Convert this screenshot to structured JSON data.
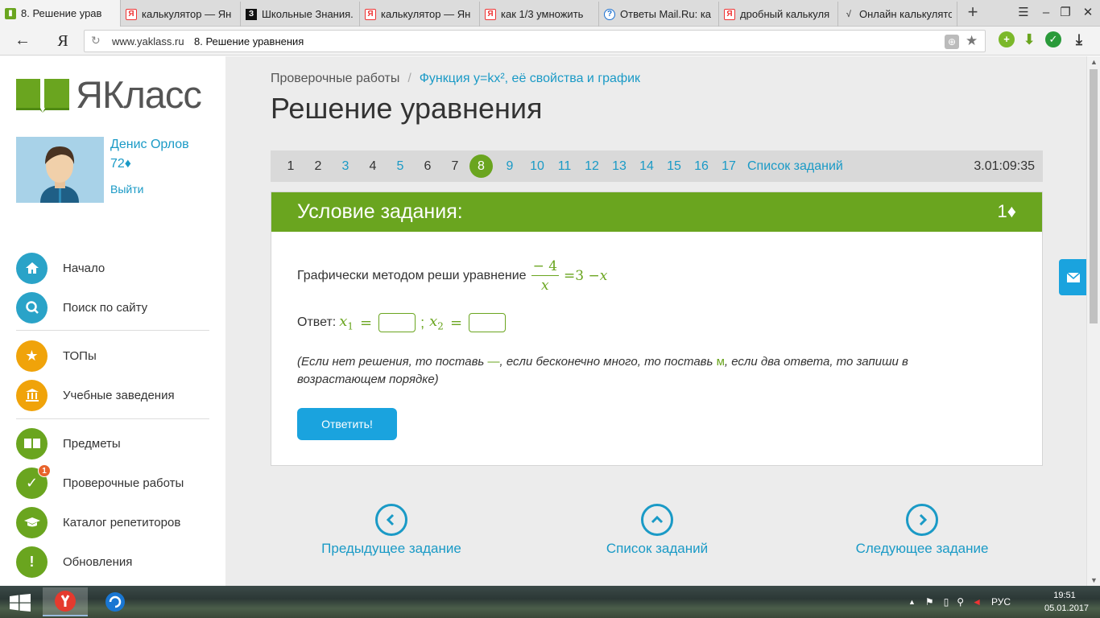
{
  "browser": {
    "tabs": [
      {
        "title": "8. Решение урав",
        "favicon": "yaklass",
        "active": true
      },
      {
        "title": "калькулятор — Ян",
        "favicon": "yandex"
      },
      {
        "title": "Школьные Знания.",
        "favicon": "znania"
      },
      {
        "title": "калькулятор — Ян",
        "favicon": "yandex"
      },
      {
        "title": "как 1/3 умножить",
        "favicon": "yandex"
      },
      {
        "title": "Ответы Mail.Ru: ка",
        "favicon": "mailru"
      },
      {
        "title": "дробный калькуля",
        "favicon": "yandex"
      },
      {
        "title": "Онлайн калькулято",
        "favicon": "calc"
      }
    ],
    "address": {
      "domain": "www.yaklass.ru",
      "page_title": "8. Решение уравнения"
    },
    "yandex_logo": "Я"
  },
  "sidebar": {
    "logo_text": "ЯКласс",
    "user": {
      "name": "Денис Орлов",
      "points": "72♦",
      "logout": "Выйти"
    },
    "menu": [
      {
        "label": "Начало",
        "icon": "home-icon",
        "color": "#2aa3c8"
      },
      {
        "label": "Поиск по сайту",
        "icon": "search-icon",
        "color": "#2aa3c8"
      },
      {
        "label": "ТОПы",
        "icon": "star-icon",
        "color": "#f0a30a"
      },
      {
        "label": "Учебные заведения",
        "icon": "school-icon",
        "color": "#f0a30a"
      },
      {
        "label": "Предметы",
        "icon": "book-icon",
        "color": "#6aa51f"
      },
      {
        "label": "Проверочные работы",
        "icon": "check-icon",
        "color": "#6aa51f",
        "badge": "1"
      },
      {
        "label": "Каталог репетиторов",
        "icon": "graduation-cap-icon",
        "color": "#6aa51f"
      },
      {
        "label": "Обновления",
        "icon": "exclamation-icon",
        "color": "#6aa51f"
      }
    ]
  },
  "main": {
    "breadcrumb": {
      "root": "Проверочные работы",
      "sep": "/",
      "current": "Функция y=kx², её свойства и график"
    },
    "title": "Решение уравнения",
    "task_numbers": [
      {
        "n": "1",
        "state": "done"
      },
      {
        "n": "2",
        "state": "done"
      },
      {
        "n": "3",
        "state": "todo"
      },
      {
        "n": "4",
        "state": "done"
      },
      {
        "n": "5",
        "state": "todo"
      },
      {
        "n": "6",
        "state": "done"
      },
      {
        "n": "7",
        "state": "done"
      },
      {
        "n": "8",
        "state": "current"
      },
      {
        "n": "9",
        "state": "todo"
      },
      {
        "n": "10",
        "state": "todo"
      },
      {
        "n": "11",
        "state": "todo"
      },
      {
        "n": "12",
        "state": "todo"
      },
      {
        "n": "13",
        "state": "todo"
      },
      {
        "n": "14",
        "state": "todo"
      },
      {
        "n": "15",
        "state": "todo"
      },
      {
        "n": "16",
        "state": "todo"
      },
      {
        "n": "17",
        "state": "todo"
      }
    ],
    "task_list_link": "Список заданий",
    "timer": "3.01:09:35",
    "task": {
      "header": "Условие задания:",
      "points": "1♦",
      "question": "Графически методом реши уравнение",
      "numerator": "− 4",
      "denominator": "x",
      "rhs": "=3 −",
      "rhs_var": "x",
      "answer_label": "Ответ:",
      "x1": "x",
      "x1_sub": "1",
      "x2": "x",
      "x2_sub": "2",
      "eq": "=",
      "semicolon": ";",
      "x1_value": "",
      "x2_value": "",
      "hint_1": "(Если нет решения, то поставь ",
      "hint_dash": "—",
      "hint_2": ", если бесконечно много, то поставь ",
      "hint_m": "м",
      "hint_3": ", если два ответа, то запиши в возрастающем порядке)",
      "submit": "Ответить!"
    },
    "nav": {
      "prev": "Предыдущее задание",
      "list": "Список заданий",
      "next": "Следующее задание"
    }
  },
  "os": {
    "tray_lang": "РУС",
    "time": "19:51",
    "date": "05.01.2017"
  }
}
